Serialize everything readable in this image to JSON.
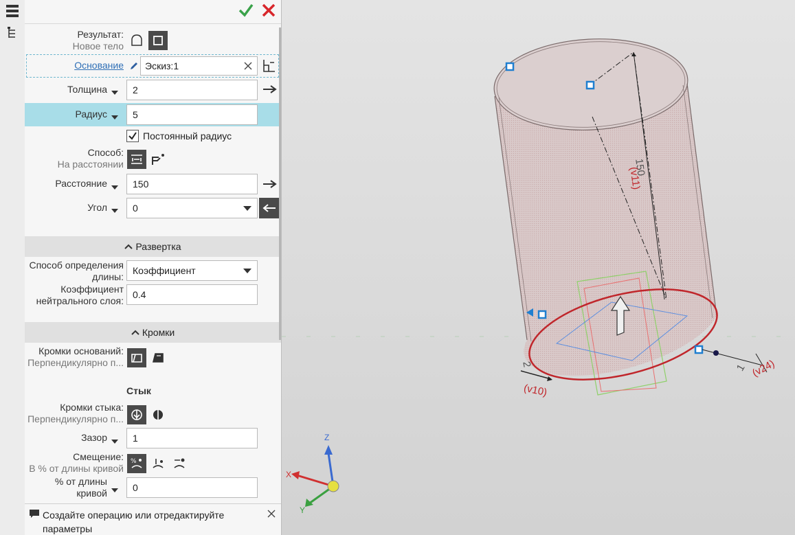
{
  "panel": {
    "result": {
      "label": "Результат:",
      "value": "Новое тело"
    },
    "base": {
      "label": "Основание",
      "value": "Эскиз:1"
    },
    "thickness": {
      "label": "Толщина",
      "value": "2"
    },
    "radius": {
      "label": "Радиус",
      "value": "5"
    },
    "constant_radius": {
      "label": "Постоянный радиус",
      "checked": true
    },
    "method": {
      "label": "Способ:",
      "value": "На расстоянии"
    },
    "distance": {
      "label": "Расстояние",
      "value": "150"
    },
    "angle": {
      "label": "Угол",
      "value": "0"
    },
    "unfold_section": "Развертка",
    "length_method": {
      "label_line1": "Способ определения",
      "label_line2": "длины:",
      "value": "Коэффициент"
    },
    "neutral_coef": {
      "label_line1": "Коэффициент",
      "label_line2": "нейтрального слоя:",
      "value": "0.4"
    },
    "edges_section": "Кромки",
    "base_edges": {
      "label": "Кромки оснований:",
      "value": "Перпендикулярно п..."
    },
    "joint_title": "Стык",
    "joint_edges": {
      "label": "Кромки стыка:",
      "value": "Перпендикулярно п..."
    },
    "gap": {
      "label": "Зазор",
      "value": "1"
    },
    "offset": {
      "label": "Смещение:",
      "value": "В % от длины кривой"
    },
    "percent": {
      "label_line1": "% от длины",
      "label_line2": "кривой",
      "value": "0"
    },
    "hint": {
      "line1": "Создайте операцию или отредактируйте",
      "line2": "параметры"
    }
  },
  "viewport": {
    "dim_height": "150",
    "var_height": "(v11)",
    "dim_radius": "2",
    "var_radius": "(v10)",
    "dim_thick": "1",
    "var_thick": "(v24)",
    "axis_x": "X",
    "axis_y": "Y",
    "axis_z": "Z"
  },
  "colors": {
    "accept": "#3aa24a",
    "cancel": "#d8262b",
    "highlight": "#a8dde8",
    "sketch_red": "#c0262b"
  }
}
